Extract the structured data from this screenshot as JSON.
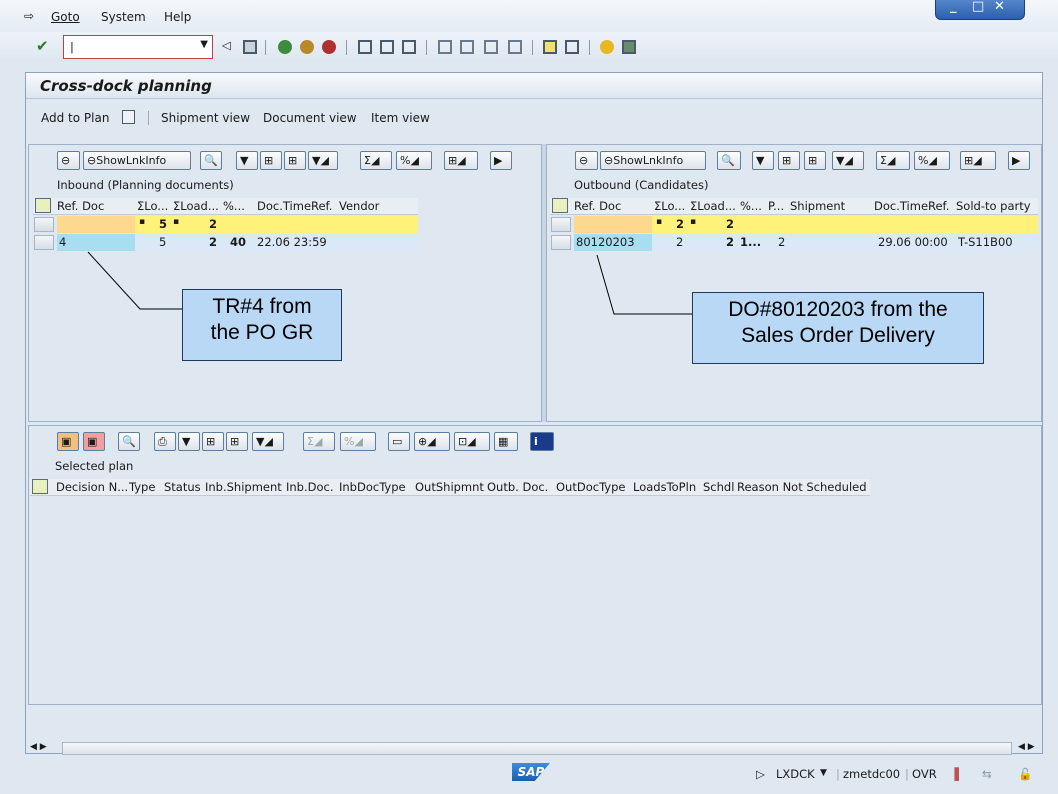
{
  "menu": {
    "goto": "Goto",
    "system": "System",
    "help": "Help"
  },
  "toolbar": {
    "command_value": "|"
  },
  "screen": {
    "title": "Cross-dock planning",
    "app_buttons": {
      "add_to_plan": "Add to Plan",
      "shipment_view": "Shipment view",
      "document_view": "Document view",
      "item_view": "Item view"
    }
  },
  "inbound": {
    "link_button": "ShowLnkInfo",
    "title": "Inbound (Planning documents)",
    "columns": [
      "Ref. Doc",
      "ΣLo...",
      "ΣLoad...",
      "%...",
      "Doc.TimeRef.",
      "Vendor"
    ],
    "sum_row": {
      "lo": "5",
      "load": "2"
    },
    "rows": [
      {
        "ref": "4",
        "lo": "5",
        "load": "2",
        "pct": "40",
        "time": "22.06 23:59"
      }
    ]
  },
  "outbound": {
    "link_button": "ShowLnkInfo",
    "title": "Outbound (Candidates)",
    "columns": [
      "Ref. Doc",
      "ΣLo...",
      "ΣLoad...",
      "%...",
      "P...",
      "Shipment",
      "Doc.TimeRef.",
      "Sold-to party"
    ],
    "sum_row": {
      "lo": "2",
      "load": "2"
    },
    "rows": [
      {
        "ref": "80120203",
        "lo": "2",
        "load": "2",
        "pct": "1...",
        "p": "2",
        "time": "29.06 00:00",
        "sold_to": "T-S11B00"
      }
    ]
  },
  "plan": {
    "title": "Selected plan",
    "columns": [
      "Decision N...",
      "Type",
      "Status",
      "Inb.Shipment",
      "Inb.Doc.",
      "InbDocType",
      "OutShipmnt",
      "Outb. Doc.",
      "OutDocType",
      "LoadsToPln",
      "Schdl",
      "Reason Not Scheduled"
    ]
  },
  "callouts": {
    "inbound": [
      "TR#4 from",
      "the PO GR"
    ],
    "outbound": [
      "DO#80120203 from the",
      "Sales Order Delivery"
    ]
  },
  "status": {
    "sap_logo": "SAP",
    "transaction": "LXDCK",
    "server": "zmetdc00",
    "mode": "OVR"
  }
}
